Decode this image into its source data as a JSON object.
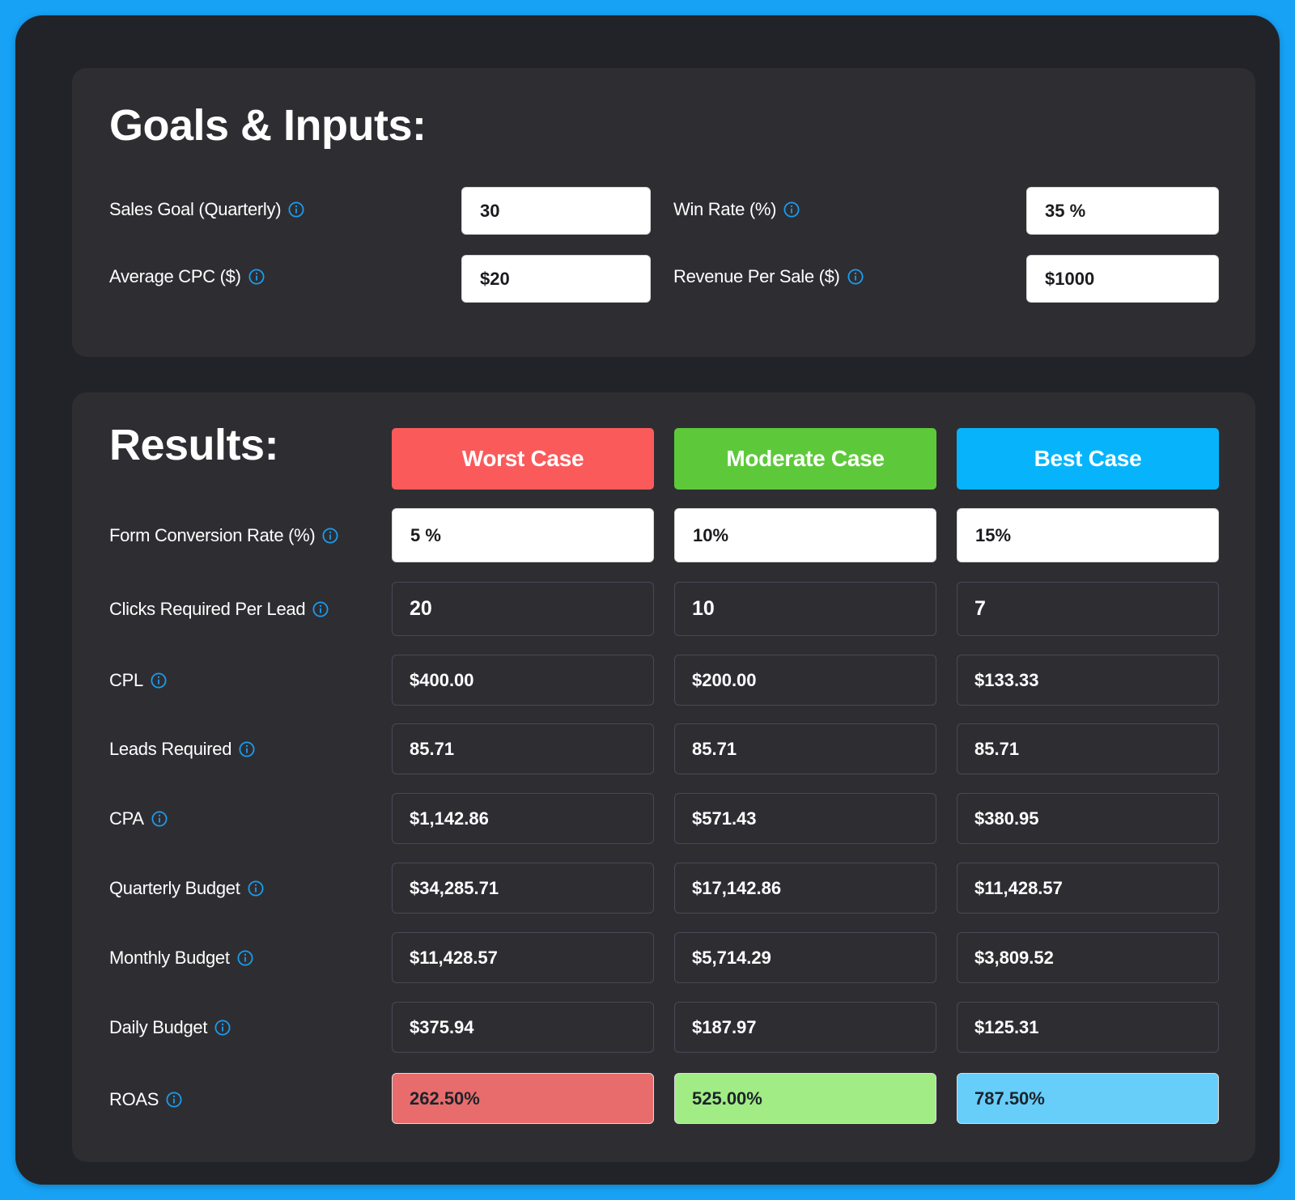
{
  "colors": {
    "page_background": "#17a2f5",
    "info_icon": "#1a9cf0",
    "worst": "#fb5a5a",
    "moderate": "#5dc93a",
    "best": "#07b4fc",
    "roas_worst": "#e86c6c",
    "roas_moderate": "#a1ec84",
    "roas_best": "#67cdf9"
  },
  "goals": {
    "title": "Goals & Inputs:",
    "fields": [
      {
        "label": "Sales Goal (Quarterly)",
        "value": "30",
        "icon": "info-icon"
      },
      {
        "label": "Win Rate (%)",
        "value": "35 %",
        "icon": "info-icon"
      },
      {
        "label": "Average CPC ($)",
        "value": "$20",
        "icon": "info-icon"
      },
      {
        "label": "Revenue Per Sale ($)",
        "value": "$1000",
        "icon": "info-icon"
      }
    ]
  },
  "results": {
    "title": "Results:",
    "cases": [
      "Worst Case",
      "Moderate Case",
      "Best Case"
    ],
    "conversion": {
      "label": "Form Conversion Rate (%)",
      "values": [
        "5 %",
        "10%",
        "15%"
      ]
    },
    "rows": [
      {
        "label": "Clicks Required Per Lead",
        "values": [
          "20",
          "10",
          "7"
        ]
      },
      {
        "label": "CPL",
        "values": [
          "$400.00",
          "$200.00",
          "$133.33"
        ]
      },
      {
        "label": "Leads Required",
        "values": [
          "85.71",
          "85.71",
          "85.71"
        ]
      },
      {
        "label": "CPA",
        "values": [
          "$1,142.86",
          "$571.43",
          "$380.95"
        ]
      },
      {
        "label": "Quarterly Budget",
        "values": [
          "$34,285.71",
          "$17,142.86",
          "$11,428.57"
        ]
      },
      {
        "label": "Monthly Budget",
        "values": [
          "$11,428.57",
          "$5,714.29",
          "$3,809.52"
        ]
      },
      {
        "label": "Daily Budget",
        "values": [
          "$375.94",
          "$187.97",
          "$125.31"
        ]
      }
    ],
    "roas": {
      "label": "ROAS",
      "values": [
        "262.50%",
        "525.00%",
        "787.50%"
      ]
    }
  }
}
